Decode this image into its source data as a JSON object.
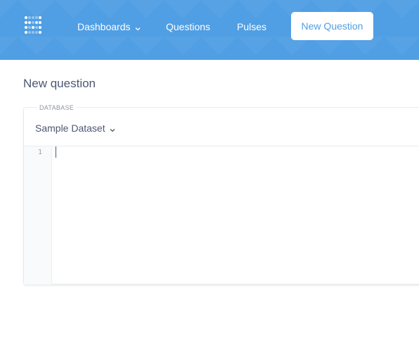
{
  "nav": {
    "logo_icon": "metabase-logo-icon",
    "items": [
      {
        "label": "Dashboards",
        "has_dropdown": true
      },
      {
        "label": "Questions"
      },
      {
        "label": "Pulses"
      }
    ],
    "new_question_label": "New Question"
  },
  "page": {
    "title": "New question"
  },
  "editor": {
    "database_label": "DATABASE",
    "database_selected": "Sample Dataset",
    "line_numbers": [
      "1"
    ],
    "query": ""
  },
  "colors": {
    "brand": "#509ee3",
    "text_dark": "#4c5773",
    "text_light": "#8d94a1",
    "border": "#e8ebef"
  }
}
